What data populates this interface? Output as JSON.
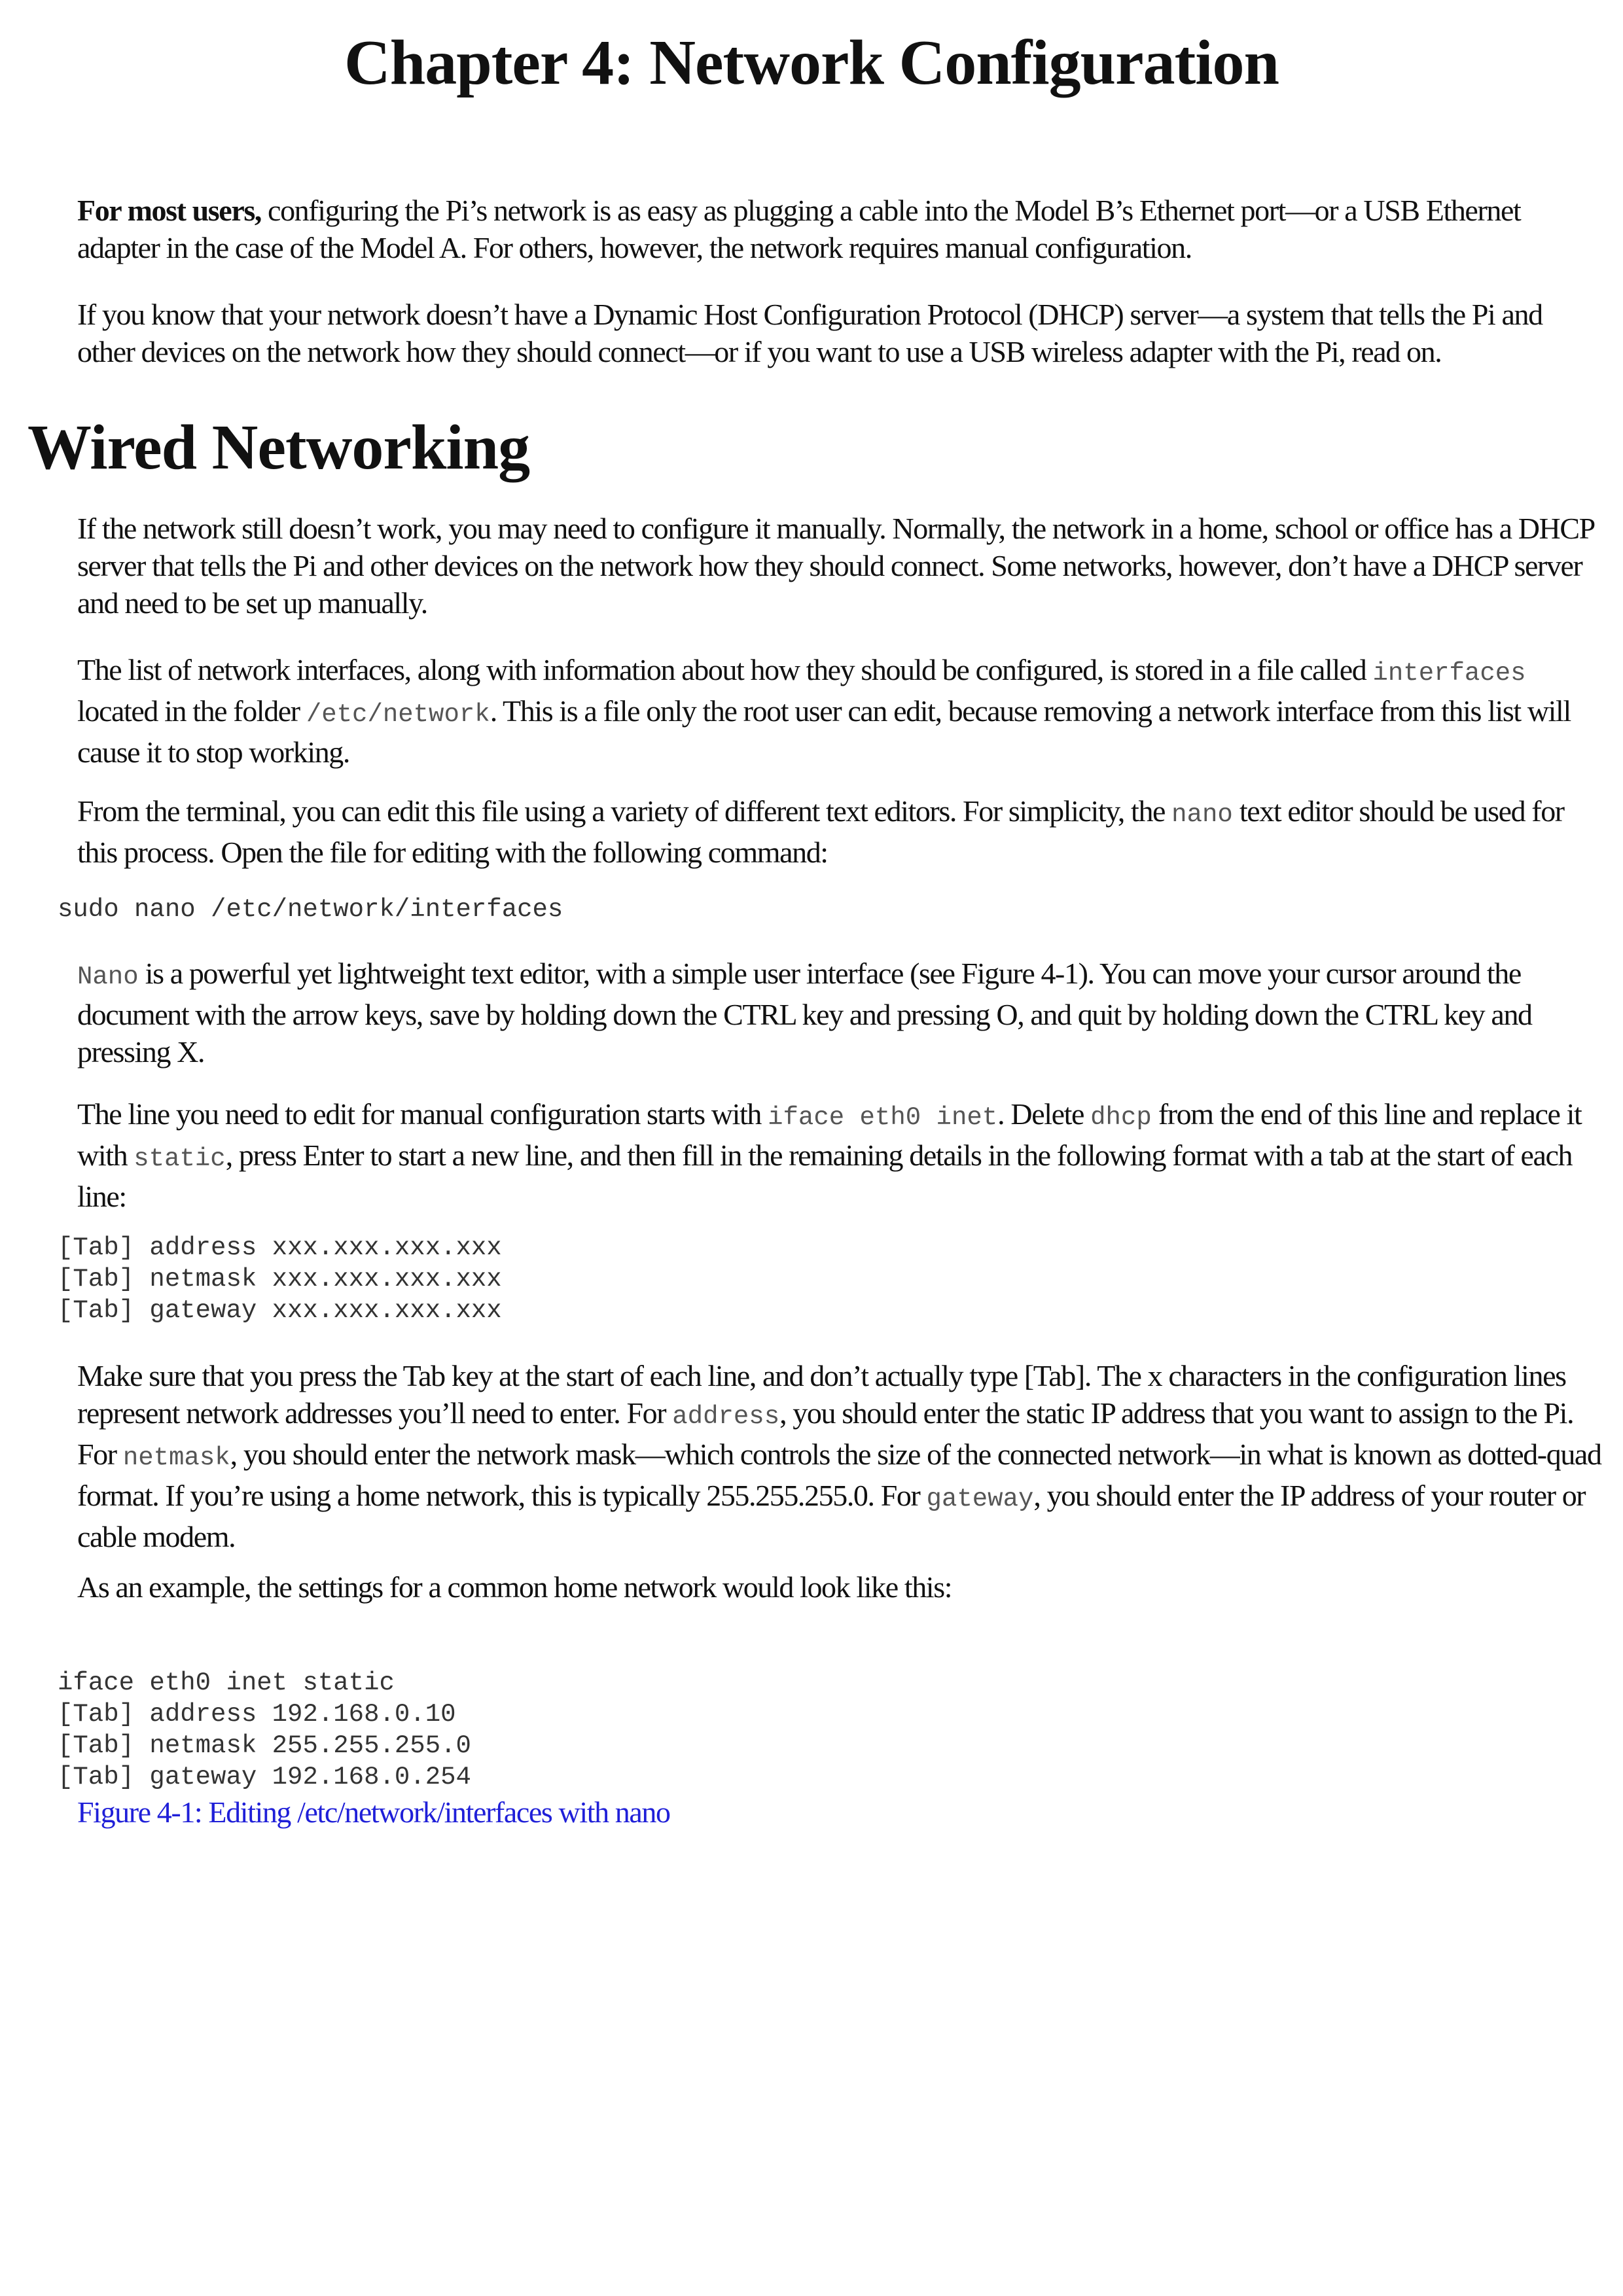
{
  "chapter_title": "Chapter 4: Network Configuration",
  "intro": {
    "p1_lead": "For most users,",
    "p1_rest": " configuring the Pi’s network is as easy as plugging a cable into the Model B’s Ethernet port—or a USB Ethernet adapter in the case of the Model A. For others, however, the network requires manual configuration.",
    "p2": "If you know that your network doesn’t have a Dynamic Host Configuration Protocol (DHCP) server—a system that tells the Pi and other devices on the network how they should connect—or if you want to use a USB wireless adapter with the Pi, read on."
  },
  "section_title": "Wired Networking",
  "body": {
    "p3": "If the network still doesn’t work, you may need to configure it manually. Normally, the network in a home, school or office has a DHCP server that tells the Pi and other devices on the network how they should connect. Some networks, however, don’t have a DHCP server and need to be set up manually.",
    "p4_a": "The list of network interfaces, along with information about how they should be configured, is stored in a file called ",
    "p4_code1": "interfaces",
    "p4_b": " located in the folder ",
    "p4_code2": "/etc/network",
    "p4_c": ". This is a file only the root user can edit, because removing a network interface from this list will cause it to stop working.",
    "p5_a": "From the terminal, you can edit this file using a variety of different text editors. For simplicity, the ",
    "p5_code": "nano",
    "p5_b": " text editor should be used for this process. Open the file for editing with the following command:",
    "code1": "sudo nano /etc/network/interfaces",
    "p6_code": "Nano",
    "p6_rest": " is a powerful yet lightweight text editor, with a simple user interface (see Figure 4-1). You can move your cursor around the document with the arrow keys, save by holding down the CTRL key and pressing O, and quit by holding down the CTRL key and pressing X.",
    "p7_a": "The line you need to edit for manual configuration starts with ",
    "p7_code1": "iface eth0 inet",
    "p7_b": ". Delete ",
    "p7_code2": "dhcp",
    "p7_c": " from the end of this line and replace it with ",
    "p7_code3": "static",
    "p7_d": ", press Enter to start a new line, and then fill in the remaining details in the following format with a tab at the start of each line:",
    "code2": "[Tab] address xxx.xxx.xxx.xxx\n[Tab] netmask xxx.xxx.xxx.xxx\n[Tab] gateway xxx.xxx.xxx.xxx",
    "p8_a": "Make sure that you press the Tab key at the start of each line, and don’t actually type [Tab]. The x characters in the configuration lines represent network addresses you’ll need to enter. For ",
    "p8_code1": "address",
    "p8_b": ", you should enter the static IP address that you want to assign to the Pi. For ",
    "p8_code2": "netmask",
    "p8_c": ", you should enter the network mask—which controls the size of the connected network—in what is known as dotted-quad format. If you’re using a home network, this is typically 255.255.255.0. For ",
    "p8_code3": "gateway",
    "p8_d": ", you should enter the IP address of your router or cable modem.",
    "p9": "As an example, the settings for a common home network would look like this:",
    "code3": "iface eth0 inet static\n[Tab] address 192.168.0.10\n[Tab] netmask 255.255.255.0\n[Tab] gateway 192.168.0.254",
    "caption": "Figure 4-1: Editing /etc/network/interfaces with nano"
  }
}
